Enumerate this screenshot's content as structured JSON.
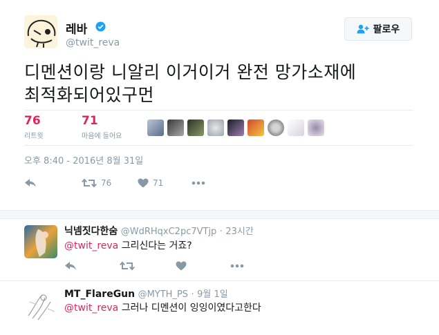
{
  "tweet": {
    "author_name": "레바",
    "author_handle": "@twit_reva",
    "follow_label": "팔로우",
    "text_line1": "디멘션이랑 니알리 이거이거 완전 망가소재에",
    "text_line2": "최적화되어있구먼",
    "retweets": {
      "count": "76",
      "label": "리트윗"
    },
    "likes": {
      "count": "71",
      "label": "마음에 들어요"
    },
    "timestamp": "오후 8:40 - 2016년 8월 31일",
    "actions": {
      "retweet_count": "76",
      "like_count": "71"
    },
    "accent_color": "#e0245e",
    "verified_color": "#1da1f2"
  },
  "replies": [
    {
      "name": "닉넴짓다한숨",
      "handle": "@WdRHqxC2pc7VTjp",
      "dot": "·",
      "time": "23시간",
      "mention": "@twit_reva",
      "text": " 그리신다는 거죠?"
    },
    {
      "name": "MT_FlareGun",
      "handle": "@MYTH_PS",
      "dot": "·",
      "time": "9월 1일",
      "mention": "@twit_reva",
      "text": " 그러나 디멘션이 잉잉이였다고한다"
    }
  ],
  "icons": [
    "verified-icon",
    "follow-person-icon",
    "reply-icon",
    "retweet-icon",
    "heart-icon",
    "more-icon"
  ]
}
